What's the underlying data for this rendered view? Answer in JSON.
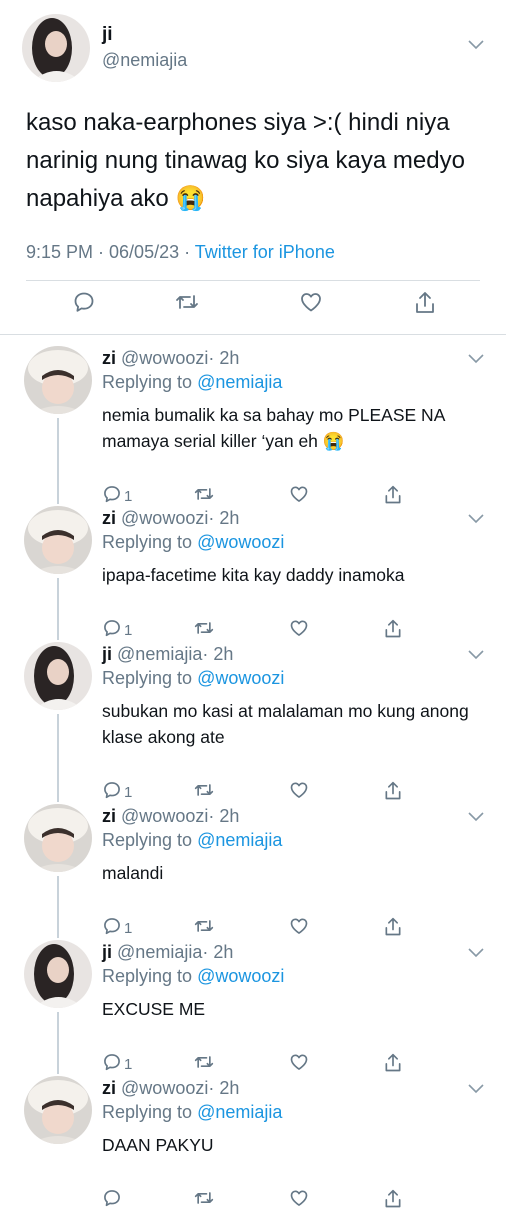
{
  "main_tweet": {
    "name": "ji",
    "handle": "@nemiajia",
    "text": "kaso naka-earphones siya >:( hindi niya narinig nung tinawag ko siya kaya medyo napahiya ako 😭",
    "time": "9:15 PM · 06/05/23 · ",
    "source": "Twitter for iPhone"
  },
  "replies": [
    {
      "name": "zi",
      "handle": "@wowoozi",
      "age": "· 2h",
      "replying_label": "Replying to ",
      "replying_to": "@nemiajia",
      "text": "nemia bumalik ka sa bahay mo PLEASE NA mamaya serial killer ‘yan eh 😭",
      "reply_count": "1"
    },
    {
      "name": "zi",
      "handle": "@wowoozi",
      "age": "· 2h",
      "replying_label": "Replying to ",
      "replying_to": "@wowoozi",
      "text": "ipapa-facetime kita kay daddy inamoka",
      "reply_count": "1"
    },
    {
      "name": "ji",
      "handle": "@nemiajia",
      "age": "· 2h",
      "replying_label": "Replying to ",
      "replying_to": "@wowoozi",
      "text": "subukan mo kasi at malalaman mo kung anong klase akong ate",
      "reply_count": "1"
    },
    {
      "name": "zi",
      "handle": "@wowoozi",
      "age": "· 2h",
      "replying_label": "Replying to ",
      "replying_to": "@nemiajia",
      "text": "malandi",
      "reply_count": "1"
    },
    {
      "name": "ji",
      "handle": "@nemiajia",
      "age": "· 2h",
      "replying_label": "Replying to ",
      "replying_to": "@wowoozi",
      "text": "EXCUSE ME",
      "reply_count": "1"
    },
    {
      "name": "zi",
      "handle": "@wowoozi",
      "age": "· 2h",
      "replying_label": "Replying to ",
      "replying_to": "@nemiajia",
      "text": "DAAN PAKYU",
      "reply_count": ""
    }
  ],
  "icons": {
    "reply": "speech-bubble-icon",
    "retweet": "retweet-icon",
    "like": "heart-icon",
    "share": "share-icon",
    "more": "chevron-down-icon"
  },
  "colors": {
    "link": "#1b95e0",
    "secondary_text": "#657786",
    "divider": "#d9dee2"
  }
}
